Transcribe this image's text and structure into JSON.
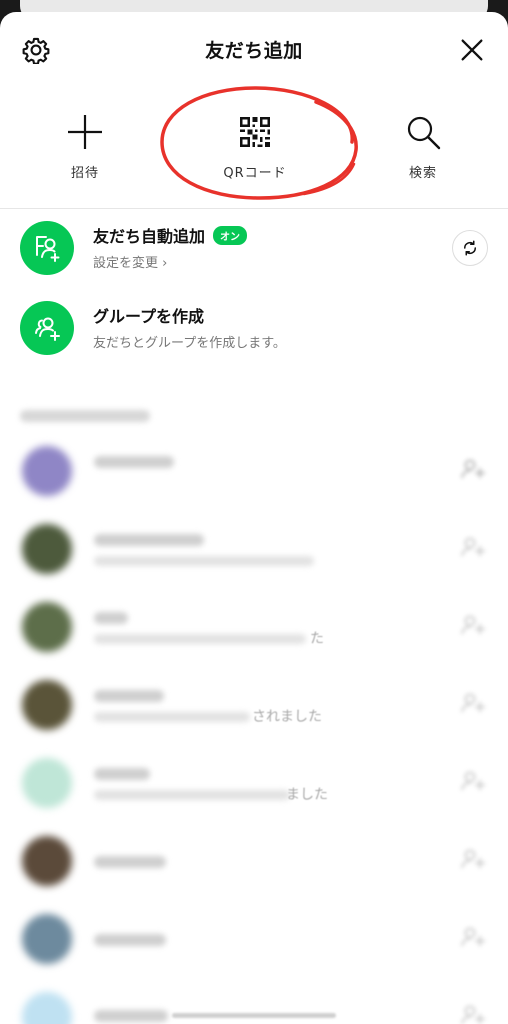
{
  "header": {
    "title": "友だち追加"
  },
  "actions": [
    {
      "label": "招待",
      "icon": "plus-icon"
    },
    {
      "label": "QRコード",
      "icon": "qr-code-icon"
    },
    {
      "label": "検索",
      "icon": "search-icon"
    }
  ],
  "auto_add": {
    "title": "友だち自動追加",
    "badge": "オン",
    "subtitle": "設定を変更 ›"
  },
  "create_group": {
    "title": "グループを作成",
    "subtitle": "友だちとグループを作成します。"
  },
  "friends": [
    {
      "tail": ""
    },
    {
      "tail": ""
    },
    {
      "tail": "た"
    },
    {
      "tail": "されました"
    },
    {
      "tail": "ました"
    },
    {
      "tail": ""
    },
    {
      "tail": ""
    },
    {
      "tail": ""
    }
  ],
  "colors": {
    "brand_green": "#06c755",
    "annotation_red": "#e8322b"
  }
}
